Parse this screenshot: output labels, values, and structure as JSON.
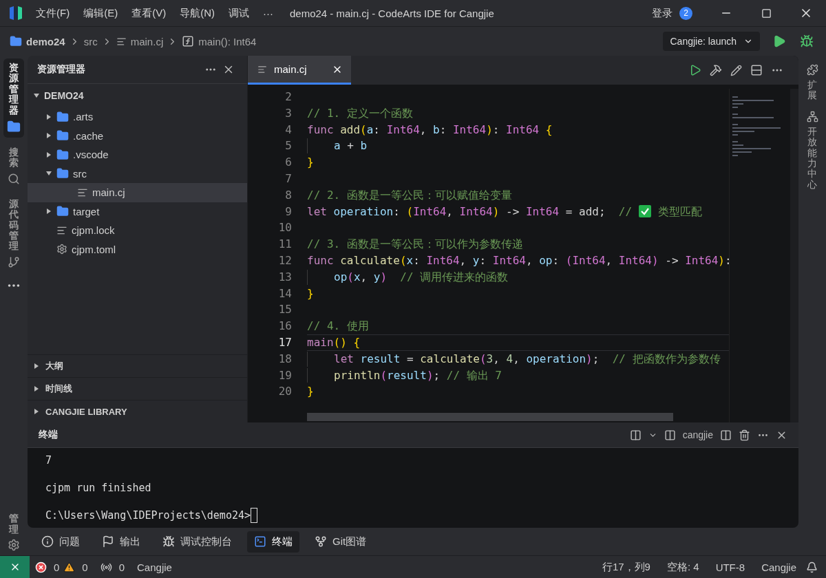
{
  "title_bar": {
    "menus": [
      "文件(F)",
      "编辑(E)",
      "查看(V)",
      "导航(N)",
      "调试",
      "···"
    ],
    "title": "demo24 - main.cj - CodeArts IDE for Cangjie",
    "login": "登录",
    "notification_count": "2"
  },
  "breadcrumbs": [
    {
      "label": "demo24",
      "kind": "folder"
    },
    {
      "label": "src",
      "kind": "plain"
    },
    {
      "label": "main.cj",
      "kind": "file"
    },
    {
      "label": "main(): Int64",
      "kind": "function"
    }
  ],
  "run_config": {
    "label": "Cangjie: launch"
  },
  "activity_bar": [
    {
      "label": "资源管理器",
      "kind": "explorer",
      "selected": true
    },
    {
      "label": "搜索",
      "kind": "search",
      "selected": false
    },
    {
      "label": "源代码管理",
      "kind": "git",
      "selected": false
    }
  ],
  "activity_bottom": {
    "label": "管理"
  },
  "explorer": {
    "title": "资源管理器",
    "root": {
      "label": "DEMO24",
      "expanded": true
    },
    "tree": [
      {
        "label": ".arts",
        "kind": "folder",
        "expanded": false,
        "selected": false
      },
      {
        "label": ".cache",
        "kind": "folder",
        "expanded": false,
        "selected": false
      },
      {
        "label": ".vscode",
        "kind": "folder",
        "expanded": false,
        "selected": false
      },
      {
        "label": "src",
        "kind": "folder",
        "expanded": true,
        "selected": false,
        "children": [
          {
            "label": "main.cj",
            "kind": "file",
            "selected": true
          }
        ]
      },
      {
        "label": "target",
        "kind": "folder",
        "expanded": false,
        "selected": false
      },
      {
        "label": "cjpm.lock",
        "kind": "file",
        "selected": false
      },
      {
        "label": "cjpm.toml",
        "kind": "config",
        "selected": false
      }
    ],
    "sections": [
      {
        "label": "大纲",
        "expanded": false
      },
      {
        "label": "时间线",
        "expanded": false
      },
      {
        "label": "CANGJIE LIBRARY",
        "expanded": false
      }
    ]
  },
  "editor": {
    "tabs": [
      {
        "label": "main.cj",
        "selected": true
      }
    ],
    "lines": [
      {
        "number": "2",
        "current": false
      },
      {
        "number": "3",
        "current": false,
        "tokens": [
          {
            "kind": "comment",
            "text": "// 1. 定义一个函数"
          }
        ]
      },
      {
        "number": "4",
        "current": false,
        "tokens": [
          {
            "kind": "keyword",
            "text": "func "
          },
          {
            "kind": "function",
            "text": "add"
          },
          {
            "kind": "bracket1",
            "text": "("
          },
          {
            "kind": "variable",
            "text": "a"
          },
          {
            "kind": "text",
            "text": ": "
          },
          {
            "kind": "type",
            "text": "Int64"
          },
          {
            "kind": "text",
            "text": ", "
          },
          {
            "kind": "variable",
            "text": "b"
          },
          {
            "kind": "text",
            "text": ": "
          },
          {
            "kind": "type",
            "text": "Int64"
          },
          {
            "kind": "bracket1",
            "text": ")"
          },
          {
            "kind": "text",
            "text": ": "
          },
          {
            "kind": "type",
            "text": "Int64 "
          },
          {
            "kind": "bracket1",
            "text": "{"
          }
        ]
      },
      {
        "number": "5",
        "current": false,
        "indented": true,
        "tokens": [
          {
            "kind": "variable",
            "text": "a"
          },
          {
            "kind": "text",
            "text": " + "
          },
          {
            "kind": "variable",
            "text": "b"
          }
        ]
      },
      {
        "number": "6",
        "current": false,
        "tokens": [
          {
            "kind": "bracket1",
            "text": "}"
          }
        ]
      },
      {
        "number": "7",
        "current": false
      },
      {
        "number": "8",
        "current": false,
        "tokens": [
          {
            "kind": "comment",
            "text": "// 2. 函数是一等公民：可以赋值给变量"
          }
        ]
      },
      {
        "number": "9",
        "current": false,
        "tokens": [
          {
            "kind": "keyword",
            "text": "let "
          },
          {
            "kind": "variable",
            "text": "operation"
          },
          {
            "kind": "text",
            "text": ": "
          },
          {
            "kind": "bracket1",
            "text": "("
          },
          {
            "kind": "type",
            "text": "Int64"
          },
          {
            "kind": "text",
            "text": ", "
          },
          {
            "kind": "type",
            "text": "Int64"
          },
          {
            "kind": "bracket1",
            "text": ")"
          },
          {
            "kind": "text",
            "text": " -> "
          },
          {
            "kind": "type",
            "text": "Int64"
          },
          {
            "kind": "text",
            "text": " = add;  "
          },
          {
            "kind": "comment",
            "text": "//"
          },
          {
            "kind": "check"
          },
          {
            "kind": "comment",
            "text": "类型匹配"
          }
        ]
      },
      {
        "number": "10",
        "current": false
      },
      {
        "number": "11",
        "current": false,
        "tokens": [
          {
            "kind": "comment",
            "text": "// 3. 函数是一等公民：可以作为参数传递"
          }
        ]
      },
      {
        "number": "12",
        "current": false,
        "tokens": [
          {
            "kind": "keyword",
            "text": "func "
          },
          {
            "kind": "function",
            "text": "calculate"
          },
          {
            "kind": "bracket1",
            "text": "("
          },
          {
            "kind": "variable",
            "text": "x"
          },
          {
            "kind": "text",
            "text": ": "
          },
          {
            "kind": "type",
            "text": "Int64"
          },
          {
            "kind": "text",
            "text": ", "
          },
          {
            "kind": "variable",
            "text": "y"
          },
          {
            "kind": "text",
            "text": ": "
          },
          {
            "kind": "type",
            "text": "Int64"
          },
          {
            "kind": "text",
            "text": ", "
          },
          {
            "kind": "variable",
            "text": "op"
          },
          {
            "kind": "text",
            "text": ": "
          },
          {
            "kind": "bracket2",
            "text": "("
          },
          {
            "kind": "type",
            "text": "Int64"
          },
          {
            "kind": "text",
            "text": ", "
          },
          {
            "kind": "type",
            "text": "Int64"
          },
          {
            "kind": "bracket2",
            "text": ")"
          },
          {
            "kind": "text",
            "text": " -> "
          },
          {
            "kind": "type",
            "text": "Int64"
          },
          {
            "kind": "bracket1",
            "text": ")"
          },
          {
            "kind": "text",
            "text": ":"
          }
        ]
      },
      {
        "number": "13",
        "current": false,
        "indented": true,
        "tokens": [
          {
            "kind": "variable",
            "text": "op"
          },
          {
            "kind": "bracket2",
            "text": "("
          },
          {
            "kind": "variable",
            "text": "x"
          },
          {
            "kind": "text",
            "text": ", "
          },
          {
            "kind": "variable",
            "text": "y"
          },
          {
            "kind": "bracket2",
            "text": ")  "
          },
          {
            "kind": "comment",
            "text": "// 调用传进来的函数"
          }
        ]
      },
      {
        "number": "14",
        "current": false,
        "tokens": [
          {
            "kind": "bracket1",
            "text": "}"
          }
        ]
      },
      {
        "number": "15",
        "current": false
      },
      {
        "number": "16",
        "current": false,
        "tokens": [
          {
            "kind": "comment",
            "text": "// 4. 使用"
          }
        ]
      },
      {
        "number": "17",
        "current": true,
        "tokens": [
          {
            "kind": "keyword",
            "text": "main"
          },
          {
            "kind": "bracket1",
            "text": "() "
          },
          {
            "kind": "bracket1",
            "text": "{"
          }
        ]
      },
      {
        "number": "18",
        "current": false,
        "indented": true,
        "tokens": [
          {
            "kind": "keyword",
            "text": "let "
          },
          {
            "kind": "variable",
            "text": "result"
          },
          {
            "kind": "text",
            "text": " = "
          },
          {
            "kind": "function",
            "text": "calculate"
          },
          {
            "kind": "bracket2",
            "text": "("
          },
          {
            "kind": "number",
            "text": "3"
          },
          {
            "kind": "text",
            "text": ", "
          },
          {
            "kind": "number",
            "text": "4"
          },
          {
            "kind": "text",
            "text": ", "
          },
          {
            "kind": "variable",
            "text": "operation"
          },
          {
            "kind": "bracket2",
            "text": ")"
          },
          {
            "kind": "text",
            "text": ";  "
          },
          {
            "kind": "comment",
            "text": "// 把函数作为参数传"
          }
        ]
      },
      {
        "number": "19",
        "current": false,
        "indented": true,
        "tokens": [
          {
            "kind": "function",
            "text": "println"
          },
          {
            "kind": "bracket2",
            "text": "("
          },
          {
            "kind": "variable",
            "text": "result"
          },
          {
            "kind": "bracket2",
            "text": ")"
          },
          {
            "kind": "text",
            "text": "; "
          },
          {
            "kind": "comment",
            "text": "// 输出 7"
          }
        ]
      },
      {
        "number": "20",
        "current": false,
        "tokens": [
          {
            "kind": "bracket1",
            "text": "}"
          }
        ]
      }
    ]
  },
  "right_bar": [
    {
      "label": "扩展",
      "kind": "extensions"
    },
    {
      "label": "开放能力中心",
      "kind": "hub"
    }
  ],
  "terminal": {
    "title": "终端",
    "profile": "cangjie",
    "lines": [
      "7",
      "cjpm run finished",
      "C:\\Users\\Wang\\IDEProjects\\demo24>"
    ]
  },
  "panel_tabs": [
    {
      "label": "问题",
      "kind": "problems",
      "selected": false
    },
    {
      "label": "输出",
      "kind": "output",
      "selected": false
    },
    {
      "label": "调试控制台",
      "kind": "debug",
      "selected": false
    },
    {
      "label": "终端",
      "kind": "terminal",
      "selected": true
    },
    {
      "label": "Git图谱",
      "kind": "git",
      "selected": false
    }
  ],
  "status_bar": {
    "errors": "0",
    "warnings": "0",
    "ports": "0",
    "language": "Cangjie",
    "position": "行17，列9",
    "indent": "空格: 4",
    "encoding": "UTF-8",
    "mode": "Cangjie"
  }
}
